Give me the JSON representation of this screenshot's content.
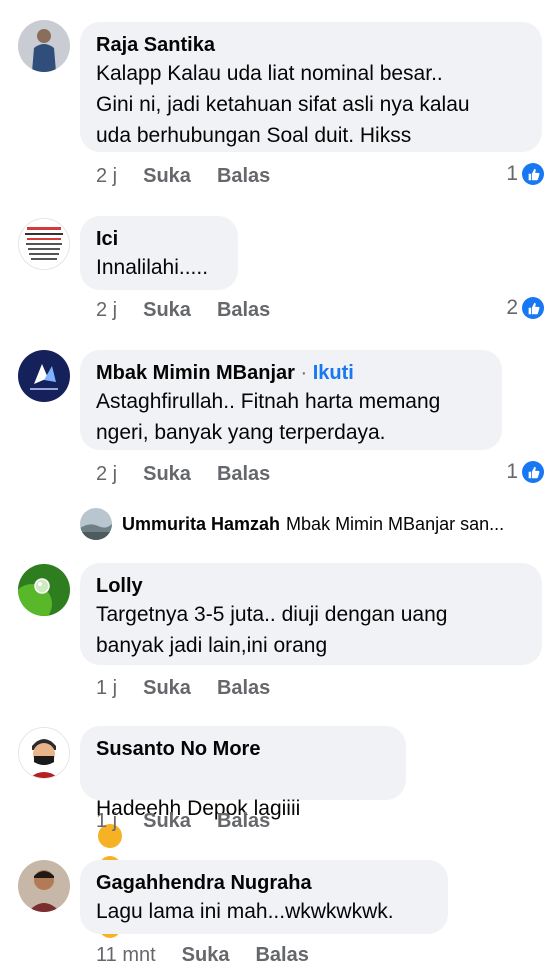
{
  "comments": [
    {
      "name": "Raja Santika",
      "text": "Kalapp Kalau uda liat nominal besar..\nGini ni, jadi ketahuan sifat asli nya kalau\nuda berhubungan Soal duit. Hikss",
      "time": "2 j",
      "like": "Suka",
      "reply": "Balas",
      "reactions": "1"
    },
    {
      "name": "Ici",
      "text": "Innalilahi.....",
      "time": "2 j",
      "like": "Suka",
      "reply": "Balas",
      "reactions": "2",
      "avatar_text": "JAGA, BIMBIN KEBENARANYA BEDITILAH MIDUP"
    },
    {
      "name": "Mbak Mimin MBanjar",
      "separator": "·",
      "follow": "Ikuti",
      "text": "Astaghfirullah.. Fitnah harta memang\nngeri, banyak yang terperdaya.",
      "time": "2 j",
      "like": "Suka",
      "reply": "Balas",
      "reactions": "1"
    },
    {
      "name": "Lolly",
      "text": "Targetnya 3-5 juta.. diuji dengan uang\nbanyak jadi lain,ini orang",
      "time": "1 j",
      "like": "Suka",
      "reply": "Balas"
    },
    {
      "name": "Susanto No More",
      "text": "Hadeehh Depok lagiiii",
      "time": "1 j",
      "like": "Suka",
      "reply": "Balas",
      "emoji": "laughing-emoji"
    },
    {
      "name": "Gagahhendra Nugraha",
      "text": "Lagu lama ini mah...wkwkwkwk.",
      "time": "11 mnt",
      "like": "Suka",
      "reply": "Balas"
    }
  ],
  "reply_preview": {
    "name": "Ummurita Hamzah",
    "text": "Mbak Mimin MBanjar san..."
  },
  "colors": {
    "bubble": "#f0f2f5",
    "accent": "#1877f2",
    "meta": "#65676b"
  }
}
